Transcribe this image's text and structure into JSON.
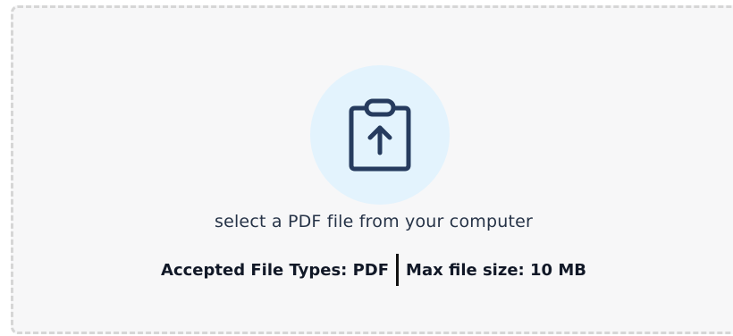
{
  "upload": {
    "instruction": "select a PDF file from your computer",
    "accepted_types": "Accepted File Types: PDF",
    "max_size": "Max file size: 10 MB",
    "icon": "clipboard-upload-icon"
  },
  "colors": {
    "border": "#d6d6d6",
    "background": "#f7f7f8",
    "icon_circle": "#e3f3fd",
    "icon_stroke": "#263b5e",
    "instruction_text": "#263347",
    "meta_text": "#111827"
  }
}
